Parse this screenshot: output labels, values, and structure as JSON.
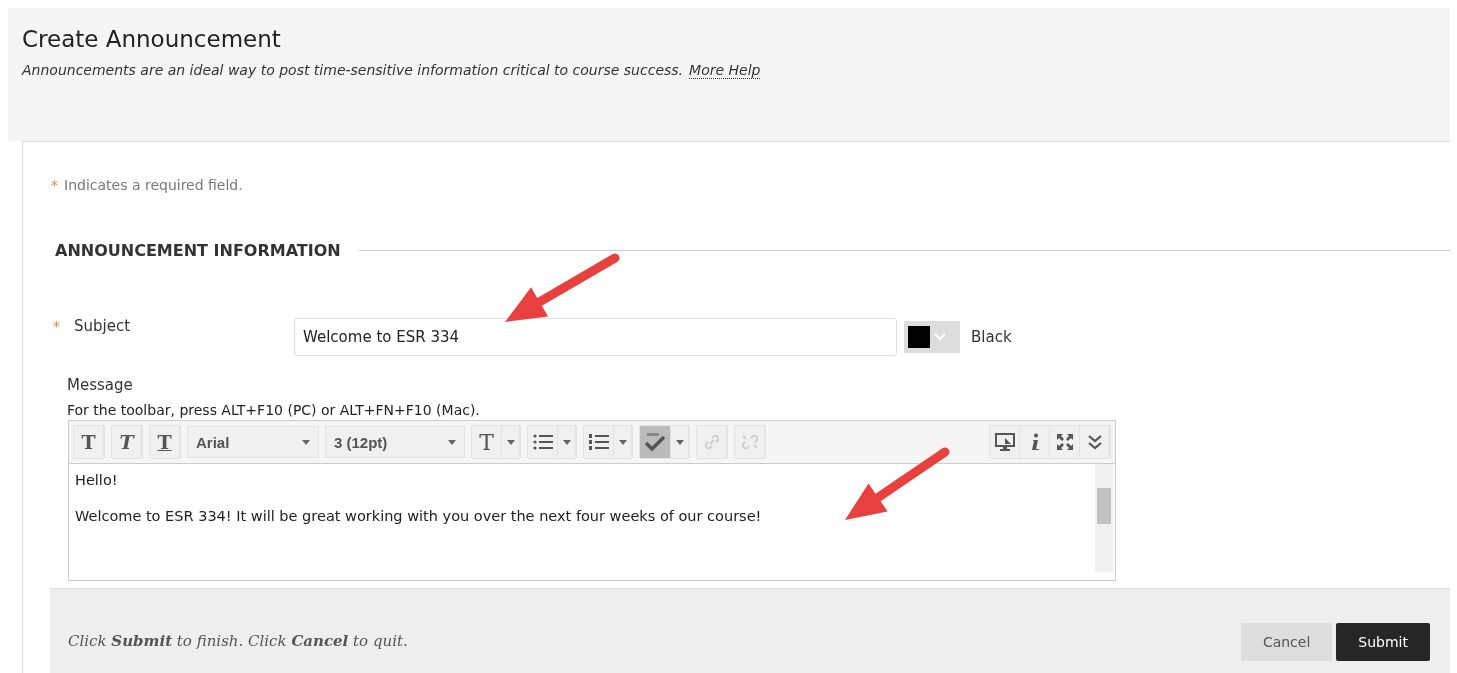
{
  "header": {
    "title": "Create Announcement",
    "description": "Announcements are an ideal way to post time-sensitive information critical to course success.",
    "help_link": "More Help"
  },
  "required_note": {
    "mark": "*",
    "text": "Indicates a required field."
  },
  "section": {
    "title": "ANNOUNCEMENT INFORMATION"
  },
  "subject": {
    "required_mark": "*",
    "label": "Subject",
    "value": "Welcome to ESR 334",
    "color": "#000000",
    "color_name": "Black"
  },
  "message": {
    "label": "Message",
    "hint": "For the toolbar, press ALT+F10 (PC) or ALT+FN+F10 (Mac).",
    "toolbar": [
      {
        "kind": "bold",
        "text": "T"
      },
      {
        "kind": "italic",
        "text": "T"
      },
      {
        "kind": "underline",
        "text": "T"
      },
      {
        "kind": "select",
        "text": "Arial"
      },
      {
        "kind": "select",
        "text": "3 (12pt)"
      },
      {
        "kind": "text_color",
        "text": "T",
        "dropdown": true
      },
      {
        "kind": "bullets",
        "dropdown": true
      },
      {
        "kind": "numbers",
        "dropdown": true
      },
      {
        "kind": "spellcheck",
        "dropdown": true,
        "active": true
      },
      {
        "kind": "link",
        "disabled": true
      },
      {
        "kind": "unlink",
        "disabled": true
      }
    ],
    "toolbar_right": [
      {
        "kind": "preview"
      },
      {
        "kind": "info"
      },
      {
        "kind": "fullscreen"
      },
      {
        "kind": "expand"
      }
    ],
    "paragraphs": [
      "Hello!",
      "Welcome to ESR 334! It will be great working with you over the next four weeks of our course!"
    ]
  },
  "footer": {
    "instructions": "Click **Submit** to finish. Click **Cancel** to quit.",
    "buttons": [
      {
        "label": "Cancel",
        "kind": "secondary"
      },
      {
        "label": "Submit",
        "kind": "primary"
      }
    ]
  },
  "annotations": [
    {
      "kind": "arrow"
    },
    {
      "kind": "arrow"
    }
  ]
}
